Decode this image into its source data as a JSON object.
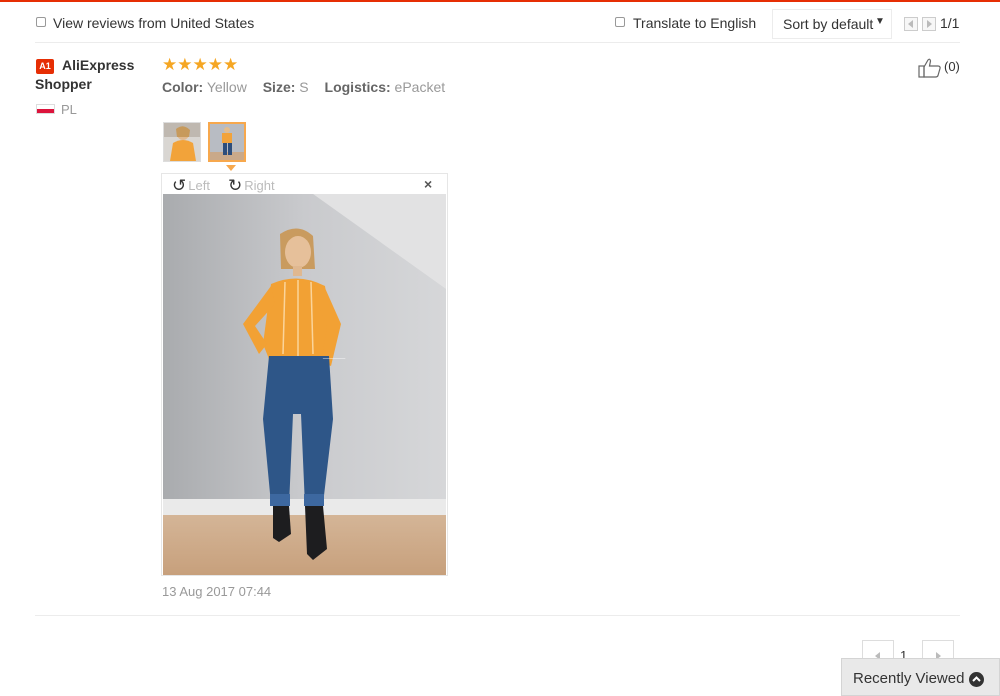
{
  "toolbar": {
    "filter_label": "View reviews from United States",
    "translate_label": "Translate to English",
    "sort_label": "Sort by default",
    "page_indicator": "1/1"
  },
  "review": {
    "badge": "A1",
    "user_name": "AliExpress Shopper",
    "country": "PL",
    "rating": 5,
    "stars_text": "★★★★★",
    "attributes": [
      {
        "key": "Color:",
        "value": "Yellow"
      },
      {
        "key": "Size:",
        "value": "S"
      },
      {
        "key": "Logistics:",
        "value": "ePacket"
      }
    ],
    "helpful_count": "(0)",
    "viewer": {
      "rotate_left": "Left",
      "rotate_right": "Right",
      "close": "×"
    },
    "date": "13 Aug 2017 07:44"
  },
  "pagination": {
    "current": "1"
  },
  "recently_viewed": {
    "label": "Recently Viewed"
  },
  "colors": {
    "accent": "#e62e04",
    "star": "#f5a623",
    "thumb_active": "#f7a84d"
  },
  "icons": [
    "checkbox-icon",
    "chevron-down-icon",
    "thumbs-up-icon",
    "rotate-left-icon",
    "rotate-right-icon",
    "close-icon",
    "chevron-up-icon"
  ]
}
